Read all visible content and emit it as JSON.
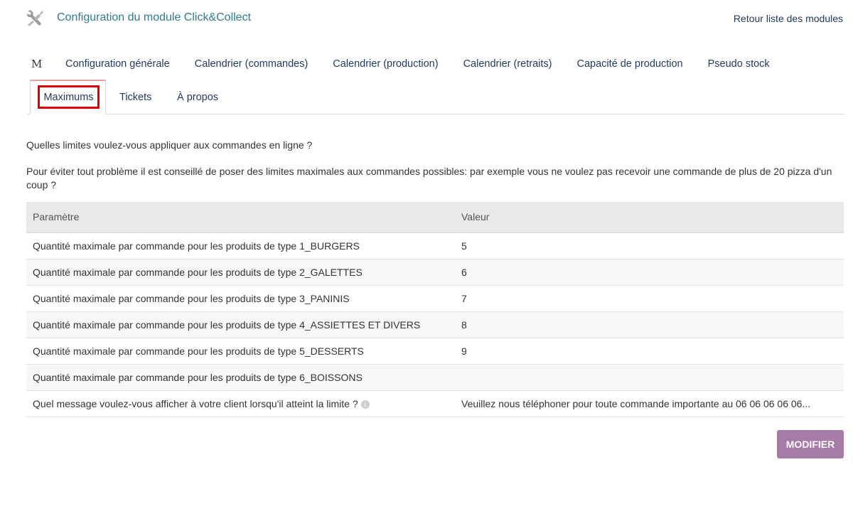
{
  "header": {
    "title": "Configuration du module Click&Collect",
    "back_link": "Retour liste des modules",
    "icon": "tools-icon"
  },
  "tabs": {
    "marker": "M",
    "row1": [
      "Configuration générale",
      "Calendrier (commandes)",
      "Calendrier (production)",
      "Calendrier (retraits)",
      "Capacité de production",
      "Pseudo stock"
    ],
    "active": "Maximums",
    "row2": [
      "Tickets",
      "À propos"
    ]
  },
  "content": {
    "question": "Quelles limites voulez-vous appliquer aux commandes en ligne ?",
    "advice": "Pour éviter tout problème il est conseillé de poser des limites maximales aux commandes possibles: par exemple vous ne voulez pas recevoir une commande de plus de 20 pizza d'un coup ?"
  },
  "table": {
    "headers": [
      "Paramètre",
      "Valeur"
    ],
    "rows": [
      [
        "Quantité maximale par commande pour les produits de type 1_BURGERS",
        "5"
      ],
      [
        "Quantité maximale par commande pour les produits de type 2_GALETTES",
        "6"
      ],
      [
        "Quantité maximale par commande pour les produits de type 3_PANINIS",
        "7"
      ],
      [
        "Quantité maximale par commande pour les produits de type 4_ASSIETTES ET DIVERS",
        "8"
      ],
      [
        "Quantité maximale par commande pour les produits de type 5_DESSERTS",
        "9"
      ],
      [
        "Quantité maximale par commande pour les produits de type 6_BOISSONS",
        ""
      ],
      [
        "Quel message voulez-vous afficher à votre client lorsqu'il atteint la limite ?",
        "Veuillez nous téléphoner pour toute commande importante au 06 06 06 06 06..."
      ]
    ]
  },
  "actions": {
    "modify_label": "MODIFIER"
  },
  "colors": {
    "accent_button": "#a77ba8",
    "title_teal": "#2e7d8c",
    "link_navy": "#1f3a5f",
    "highlight_red": "#e00000"
  }
}
